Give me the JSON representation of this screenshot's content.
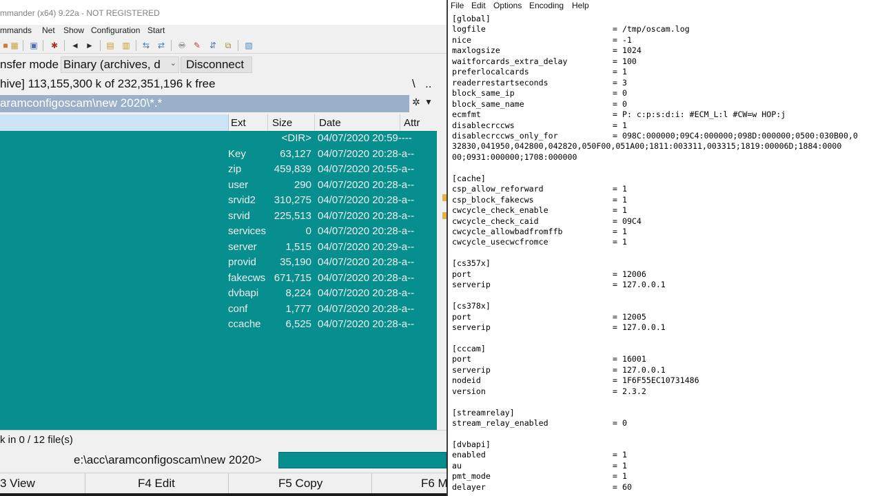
{
  "tc": {
    "title": "mmander (x64) 9.22a - NOT REGISTERED",
    "menu": [
      "mmands",
      "Net",
      "Show",
      "Configuration",
      "Start"
    ],
    "ftp": {
      "transfer_mode_label": "nsfer mode",
      "mode_value": "Binary (archives, d",
      "disconnect_label": "Disconnect"
    },
    "drive_info": "hive]  113,155,300 k of 232,351,196 k free",
    "root_btn": "\\",
    "up_btn": "..",
    "path": "aramconfigoscam\\new 2020\\*.*",
    "columns": {
      "ext": "Ext",
      "size": "Size",
      "date": "Date",
      "attr": "Attr"
    },
    "files": [
      {
        "ext": "",
        "size": "<DIR>",
        "date": "04/07/2020 20:59----"
      },
      {
        "ext": "Key",
        "size": "63,127",
        "date": "04/07/2020 20:28-a--"
      },
      {
        "ext": "zip",
        "size": "459,839",
        "date": "04/07/2020 20:55-a--"
      },
      {
        "ext": "user",
        "size": "290",
        "date": "04/07/2020 20:28-a--"
      },
      {
        "ext": "srvid2",
        "size": "310,275",
        "date": "04/07/2020 20:28-a--"
      },
      {
        "ext": "srvid",
        "size": "225,513",
        "date": "04/07/2020 20:28-a--"
      },
      {
        "ext": "services",
        "size": "0",
        "date": "04/07/2020 20:28-a--"
      },
      {
        "ext": "server",
        "size": "1,515",
        "date": "04/07/2020 20:29-a--"
      },
      {
        "ext": "provid",
        "size": "35,190",
        "date": "04/07/2020 20:28-a--"
      },
      {
        "ext": "fakecws",
        "size": "671,715",
        "date": "04/07/2020 20:28-a--"
      },
      {
        "ext": "dvbapi",
        "size": "8,224",
        "date": "04/07/2020 20:28-a--"
      },
      {
        "ext": "conf",
        "size": "1,777",
        "date": "04/07/2020 20:28-a--"
      },
      {
        "ext": "ccache",
        "size": "6,525",
        "date": "04/07/2020 20:28-a--"
      }
    ],
    "status": "k in 0 / 12 file(s)",
    "cmd_prompt": "e:\\acc\\aramconfigoscam\\new 2020>",
    "fkeys": [
      "3 View",
      "F4 Edit",
      "F5 Copy",
      "F6 M"
    ]
  },
  "np": {
    "menu": [
      "File",
      "Edit",
      "Options",
      "Encoding",
      "Help"
    ],
    "lines": [
      {
        "k": "[global]",
        "v": ""
      },
      {
        "k": "logfile",
        "v": "= /tmp/oscam.log"
      },
      {
        "k": "nice",
        "v": "= -1"
      },
      {
        "k": "maxlogsize",
        "v": "= 1024"
      },
      {
        "k": "waitforcards_extra_delay",
        "v": "= 100"
      },
      {
        "k": "preferlocalcards",
        "v": "= 1"
      },
      {
        "k": "readerrestartseconds",
        "v": "= 3"
      },
      {
        "k": "block_same_ip",
        "v": "= 0"
      },
      {
        "k": "block_same_name",
        "v": "= 0"
      },
      {
        "k": "ecmfmt",
        "v": "= P: c:p:s:d:i: #ECM_L:l #CW=w HOP:j"
      },
      {
        "k": "disablecrccws",
        "v": "= 1"
      },
      {
        "k": "disablecrccws_only_for",
        "v": "= 098C:000000;09C4:000000;098D:000000;0500:030B00,0"
      },
      {
        "k": "32830,041950,042800,042820,050F00,051A00;1811:003311,003315;1819:00006D;1884:0000",
        "v": ""
      },
      {
        "k": "00;0931:000000;1708:000000",
        "v": ""
      },
      {
        "k": "",
        "v": ""
      },
      {
        "k": "[cache]",
        "v": ""
      },
      {
        "k": "csp_allow_reforward",
        "v": "= 1"
      },
      {
        "k": "csp_block_fakecws",
        "v": "= 1"
      },
      {
        "k": "cwcycle_check_enable",
        "v": "= 1"
      },
      {
        "k": "cwcycle_check_caid",
        "v": "= 09C4"
      },
      {
        "k": "cwcycle_allowbadfromffb",
        "v": "= 1"
      },
      {
        "k": "cwcycle_usecwcfromce",
        "v": "= 1"
      },
      {
        "k": "",
        "v": ""
      },
      {
        "k": "[cs357x]",
        "v": ""
      },
      {
        "k": "port",
        "v": "= 12006"
      },
      {
        "k": "serverip",
        "v": "= 127.0.0.1"
      },
      {
        "k": "",
        "v": ""
      },
      {
        "k": "[cs378x]",
        "v": ""
      },
      {
        "k": "port",
        "v": "= 12005"
      },
      {
        "k": "serverip",
        "v": "= 127.0.0.1"
      },
      {
        "k": "",
        "v": ""
      },
      {
        "k": "[cccam]",
        "v": ""
      },
      {
        "k": "port",
        "v": "= 16001"
      },
      {
        "k": "serverip",
        "v": "= 127.0.0.1"
      },
      {
        "k": "nodeid",
        "v": "= 1F6F55EC10731486"
      },
      {
        "k": "version",
        "v": "= 2.3.2"
      },
      {
        "k": "",
        "v": ""
      },
      {
        "k": "[streamrelay]",
        "v": ""
      },
      {
        "k": "stream_relay_enabled",
        "v": "= 0"
      },
      {
        "k": "",
        "v": ""
      },
      {
        "k": "[dvbapi]",
        "v": ""
      },
      {
        "k": "enabled",
        "v": "= 1"
      },
      {
        "k": "au",
        "v": "= 1"
      },
      {
        "k": "pmt_mode",
        "v": "= 1"
      },
      {
        "k": "delayer",
        "v": "= 60"
      }
    ]
  },
  "colors": {
    "panel_bg": "#078f8f",
    "path_bg": "#9ab0c8",
    "name_header_bg": "#cde4f7"
  },
  "icons": [
    "back-arrow-icon",
    "forward-arrow-icon",
    "binoculars-icon",
    "hotlist-star-icon",
    "dropdown-arrow-icon"
  ]
}
